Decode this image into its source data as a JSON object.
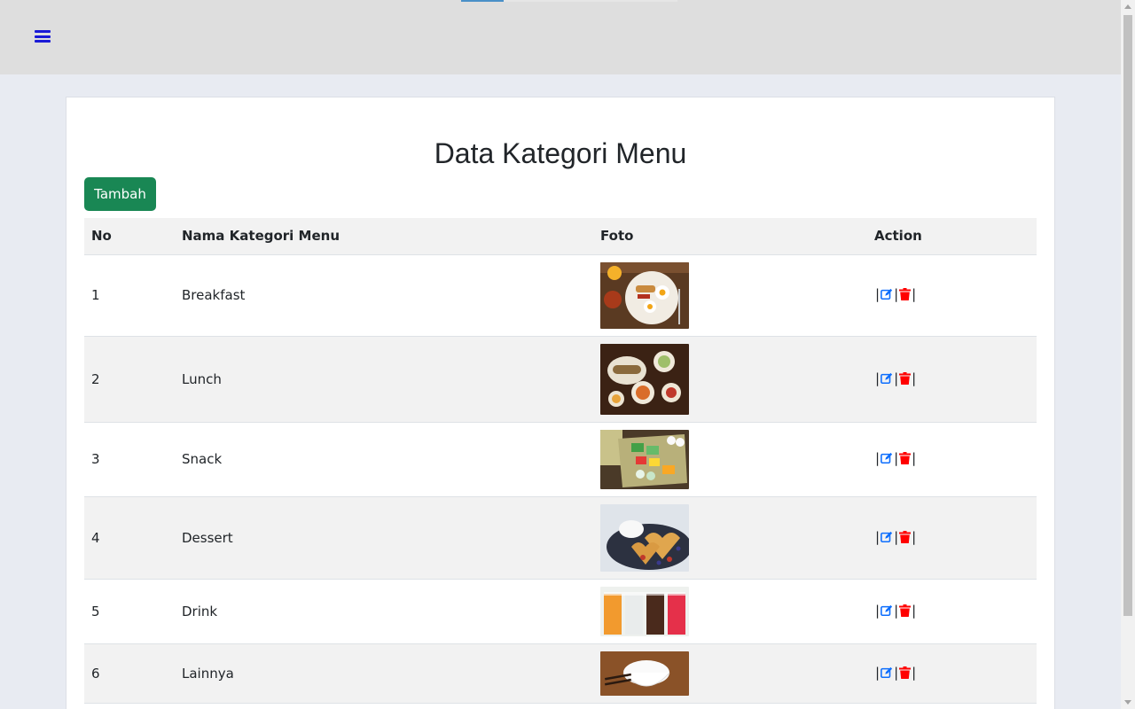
{
  "header": {
    "menu_icon": "hamburger-icon"
  },
  "page": {
    "title": "Data Kategori Menu",
    "add_button": "Tambah"
  },
  "table": {
    "columns": [
      "No",
      "Nama Kategori Menu",
      "Foto",
      "Action"
    ],
    "rows": [
      {
        "no": "1",
        "name": "Breakfast"
      },
      {
        "no": "2",
        "name": "Lunch"
      },
      {
        "no": "3",
        "name": "Snack"
      },
      {
        "no": "4",
        "name": "Dessert"
      },
      {
        "no": "5",
        "name": "Drink"
      },
      {
        "no": "6",
        "name": "Lainnya"
      }
    ],
    "separator": "|"
  },
  "colors": {
    "accent_blue": "#1a1ad6",
    "add_green": "#198754",
    "edit_blue": "#0d6efd",
    "delete_red": "#ff0000"
  }
}
